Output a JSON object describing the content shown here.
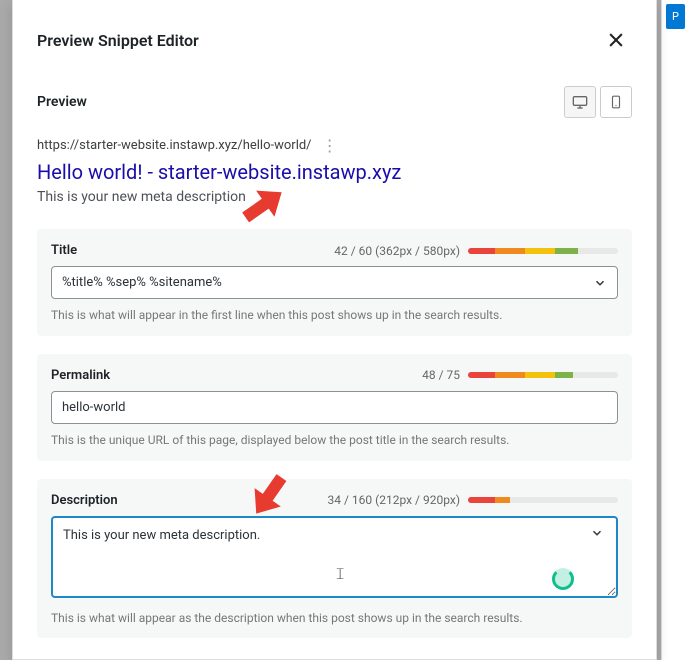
{
  "rightPanel": {
    "publishShort": "P"
  },
  "modal": {
    "title": "Preview Snippet Editor",
    "preview_label": "Preview",
    "serp": {
      "url": "https://starter-website.instawp.xyz/hello-world/",
      "title": "Hello world! - starter-website.instawp.xyz",
      "description": "This is your new meta description"
    },
    "fields": {
      "title": {
        "label": "Title",
        "count": "42 / 60 (362px / 580px)",
        "value": "%title% %sep% %sitename%",
        "help": "This is what will appear in the first line when this post shows up in the search results."
      },
      "permalink": {
        "label": "Permalink",
        "count": "48 / 75",
        "value": "hello-world",
        "help": "This is the unique URL of this page, displayed below the post title in the search results."
      },
      "description": {
        "label": "Description",
        "count": "34 / 160 (212px / 920px)",
        "value": "This is your new meta description.",
        "help": "This is what will appear as the description when this post shows up in the search results."
      }
    }
  }
}
